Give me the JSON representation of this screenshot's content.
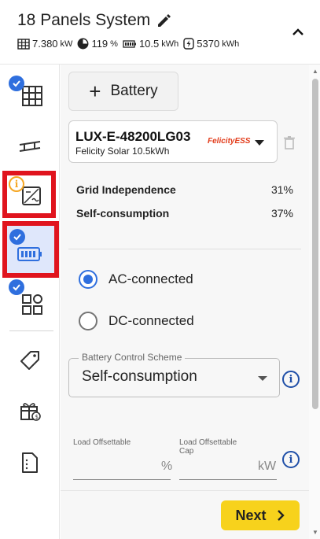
{
  "header": {
    "title": "18 Panels System",
    "stats": [
      {
        "icon": "solar-grid-icon",
        "value": "7.380",
        "unit": "kW"
      },
      {
        "icon": "pie-chart-icon",
        "value": "119",
        "unit": "%"
      },
      {
        "icon": "battery-icon",
        "value": "10.5",
        "unit": "kWh"
      },
      {
        "icon": "bolt-icon",
        "value": "5370",
        "unit": "kWh"
      }
    ]
  },
  "sidebar": {
    "items": [
      {
        "name": "panels",
        "icon": "solar-panel-grid-icon",
        "badge": "check"
      },
      {
        "name": "mounting",
        "icon": "roof-mount-icon",
        "badge": ""
      },
      {
        "name": "inverter",
        "icon": "inverter-icon",
        "badge": "info"
      },
      {
        "name": "battery",
        "icon": "battery-icon",
        "badge": "check",
        "selected": true
      },
      {
        "name": "components",
        "icon": "apps-grid-icon",
        "badge": "check"
      },
      {
        "name": "pricing",
        "icon": "price-tag-icon",
        "badge": ""
      },
      {
        "name": "incentives",
        "icon": "gift-icon",
        "badge": ""
      },
      {
        "name": "documents",
        "icon": "document-icon",
        "badge": ""
      }
    ]
  },
  "main": {
    "add_battery_label": "Battery",
    "battery_model": "LUX-E-48200LG03",
    "battery_brand": "Felicity Solar 10.5kWh",
    "brand_logo_text": "FelicityESS",
    "metrics": [
      {
        "label": "Grid Independence",
        "value": "31%"
      },
      {
        "label": "Self-consumption",
        "value": "37%"
      }
    ],
    "coupling_options": [
      {
        "label": "AC-connected",
        "selected": true
      },
      {
        "label": "DC-connected",
        "selected": false
      }
    ],
    "scheme_legend": "Battery Control Scheme",
    "scheme_value": "Self-consumption",
    "load_offsettable_label": "Load Offsettable",
    "load_offsettable_unit": "%",
    "load_offsettable_cap_label_1": "Load Offsettable",
    "load_offsettable_cap_label_2": "Cap",
    "load_offsettable_cap_unit": "kW",
    "next_label": "Next"
  },
  "colors": {
    "accent": "#2f6fde",
    "highlight_frame": "#e0141e",
    "next_button": "#f7d21c",
    "info_badge": "#f5a623"
  }
}
